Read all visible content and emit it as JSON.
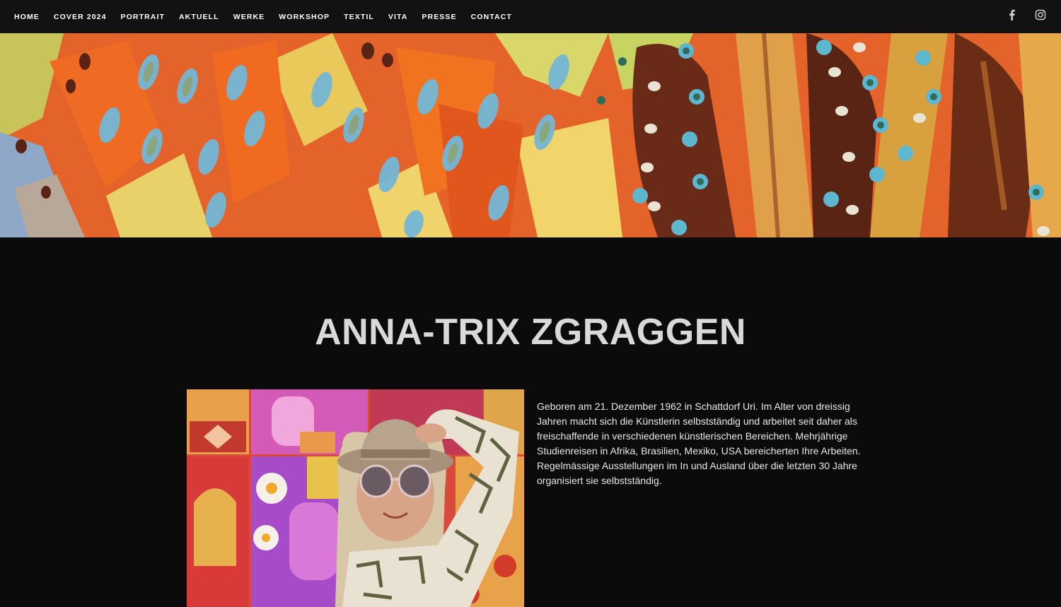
{
  "nav": {
    "items": [
      {
        "label": "HOME"
      },
      {
        "label": "COVER 2024"
      },
      {
        "label": "PORTRAIT"
      },
      {
        "label": "AKTUELL"
      },
      {
        "label": "WERKE"
      },
      {
        "label": "WORKSHOP"
      },
      {
        "label": "TEXTIL"
      },
      {
        "label": "VITA"
      },
      {
        "label": "PRESSE"
      },
      {
        "label": "CONTACT"
      }
    ],
    "social": [
      {
        "icon": "facebook-icon"
      },
      {
        "icon": "instagram-icon"
      }
    ]
  },
  "hero": {
    "image": "abstract-painting-banner"
  },
  "main": {
    "title": "ANNA-TRIX ZGRAGGEN",
    "portrait": "artist-portrait-photo",
    "bio": "Geboren am 21. Dezember 1962 in Schattdorf Uri. Im Alter von dreissig Jahren macht sich die Künstlerin selbstständig und arbeitet seit daher als freischaffende in verschiedenen künstlerischen Bereichen. Mehrjährige Studienreisen in Afrika, Brasilien, Mexiko, USA bereicherten Ihre Arbeiten. Regelmässige Ausstellungen im In und Ausland über die letzten 30 Jahre organisiert sie selbstständig."
  },
  "colors": {
    "nav_bg": "#121212",
    "page_bg": "#0b0b0b",
    "title": "#d9d9d9",
    "text": "#e8e8e8"
  }
}
